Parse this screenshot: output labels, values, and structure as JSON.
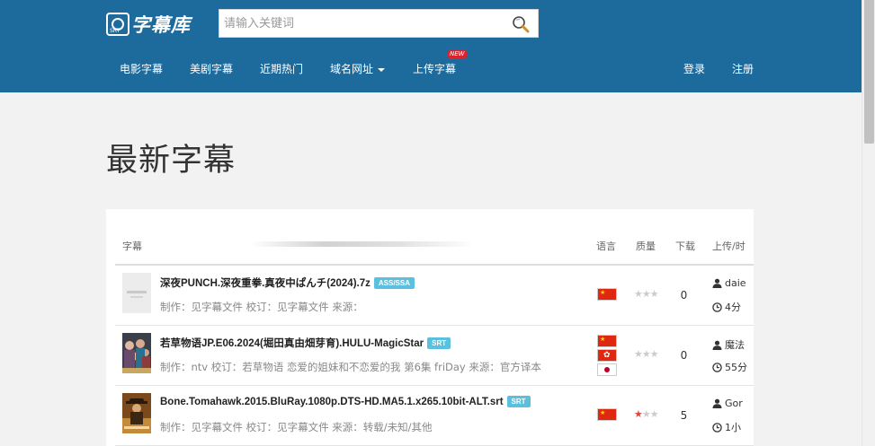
{
  "header": {
    "logo_mark": "SRT",
    "logo_text": "字幕库",
    "search_placeholder": "请输入关键词",
    "nav": [
      {
        "label": "电影字幕"
      },
      {
        "label": "美剧字幕"
      },
      {
        "label": "近期热门"
      },
      {
        "label": "域名网址"
      },
      {
        "label": "上传字幕"
      }
    ],
    "new_badge": "NEW",
    "login": "登录",
    "register": "注册"
  },
  "main": {
    "title": "最新字幕",
    "table": {
      "headers": {
        "subtitle": "字幕",
        "language": "语言",
        "quality": "质量",
        "downloads": "下载",
        "uploader": "上传/时"
      },
      "rows": [
        {
          "title": "深夜PUNCH.深夜重拳.真夜中ぱんチ(2024).7z",
          "format": "ASS/SSA",
          "meta": "制作：见字幕文件 校订：见字幕文件 来源：",
          "languages": [
            "cn"
          ],
          "rating": 0,
          "downloads": "0",
          "uploader": "daie",
          "time": "4分"
        },
        {
          "title": "若草物语JP.E06.2024(堀田真由畑芽育).HULU-MagicStar",
          "format": "SRT",
          "meta": "制作：ntv 校订：若草物语 恋爱的姐妹和不恋爱的我 第6集 friDay 来源：官方译本",
          "languages": [
            "cn",
            "hk",
            "jp"
          ],
          "rating": 0,
          "downloads": "0",
          "uploader": "魔法",
          "time": "55分"
        },
        {
          "title": "Bone.Tomahawk.2015.BluRay.1080p.DTS-HD.MA5.1.x265.10bit-ALT.srt",
          "format": "SRT",
          "meta": "制作：见字幕文件 校订：见字幕文件 来源：转载/未知/其他",
          "languages": [
            "cn"
          ],
          "rating": 1,
          "downloads": "5",
          "uploader": "Gor",
          "time": "1小"
        }
      ]
    }
  },
  "colors": {
    "header_bg": "#1d6a9c",
    "badge_blue": "#5bc0de",
    "new_badge": "#d9232d"
  }
}
